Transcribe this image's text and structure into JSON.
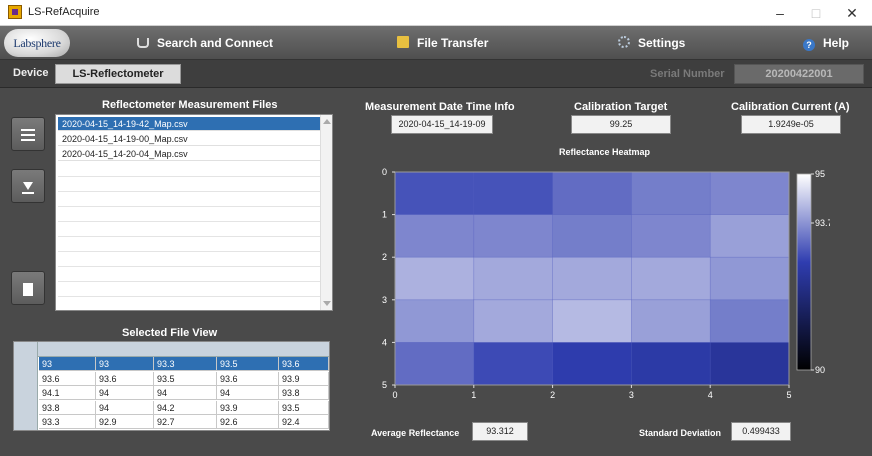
{
  "window": {
    "title": "LS-RefAcquire"
  },
  "nav": {
    "logo": "Labsphere",
    "search": "Search and Connect",
    "file_transfer": "File Transfer",
    "settings": "Settings",
    "help": "Help"
  },
  "device": {
    "label": "Device",
    "value": "LS-Reflectometer",
    "serial_label": "Serial Number",
    "serial_value": "20200422001"
  },
  "files": {
    "title": "Reflectometer Measurement Files",
    "items": [
      "2020-04-15_14-19-42_Map.csv",
      "2020-04-15_14-19-00_Map.csv",
      "2020-04-15_14-20-04_Map.csv"
    ],
    "selected_index": 0
  },
  "table": {
    "title": "Selected File View",
    "rows": [
      [
        "93",
        "93",
        "93.3",
        "93.5",
        "93.6"
      ],
      [
        "93.6",
        "93.6",
        "93.5",
        "93.6",
        "93.9"
      ],
      [
        "94.1",
        "94",
        "94",
        "94",
        "93.8"
      ],
      [
        "93.8",
        "94",
        "94.2",
        "93.9",
        "93.5"
      ],
      [
        "93.3",
        "92.9",
        "92.7",
        "92.6",
        "92.4"
      ]
    ],
    "selected_row": 0
  },
  "info": {
    "datetime_label": "Measurement Date Time Info",
    "datetime_value": "2020-04-15_14-19-09",
    "cal_target_label": "Calibration Target",
    "cal_target_value": "99.25",
    "cal_current_label": "Calibration Current (A)",
    "cal_current_value": "1.9249e-05"
  },
  "stats": {
    "avg_label": "Average Reflectance",
    "avg_value": "93.312",
    "std_label": "Standard Deviation",
    "std_value": "0.499433"
  },
  "chart_data": {
    "type": "heatmap",
    "title": "Reflectance Heatmap",
    "x_ticks": [
      "0",
      "1",
      "2",
      "3",
      "4",
      "5"
    ],
    "y_ticks": [
      "0",
      "1",
      "2",
      "3",
      "4",
      "5"
    ],
    "xlim": [
      0,
      5
    ],
    "ylim": [
      0,
      5
    ],
    "values": [
      [
        93,
        93,
        93.3,
        93.5,
        93.6
      ],
      [
        93.6,
        93.6,
        93.5,
        93.6,
        93.9
      ],
      [
        94.1,
        94,
        94,
        94,
        93.8
      ],
      [
        93.8,
        94,
        94.2,
        93.9,
        93.5
      ],
      [
        93.3,
        92.9,
        92.7,
        92.6,
        92.4
      ]
    ],
    "colorbar": {
      "min": 90,
      "max": 95,
      "ticks": [
        "95",
        "93.75",
        "90"
      ],
      "tick_values": [
        95,
        93.75,
        90
      ]
    },
    "colors": {
      "low": "#000000",
      "mid": "#2f3db0",
      "high": "#ffffff"
    }
  }
}
